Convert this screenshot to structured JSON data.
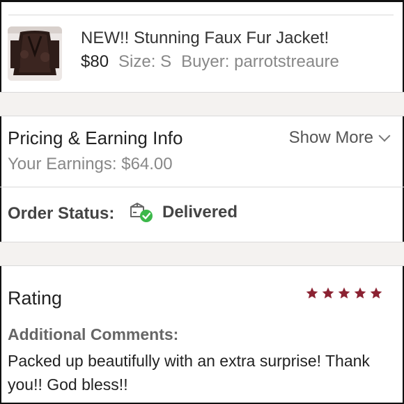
{
  "order": {
    "title": "NEW!! Stunning Faux Fur Jacket!",
    "price": "$80",
    "size": "Size: S",
    "buyer": "Buyer: parrotstreaure",
    "thumbnail_icon": "jacket-photo"
  },
  "pricing": {
    "title": "Pricing & Earning Info",
    "show_more": "Show More",
    "earnings": "Your Earnings: $64.00"
  },
  "status": {
    "label": "Order Status:",
    "value": "Delivered",
    "icon": "package-delivered-icon",
    "icon_color": "#3cb84a"
  },
  "rating": {
    "title": "Rating",
    "stars": 5,
    "star_color": "#8b2232",
    "comments_label": "Additional Comments:",
    "comment": "Packed up beautifully with an extra surprise! Thank you!! God bless!!"
  }
}
